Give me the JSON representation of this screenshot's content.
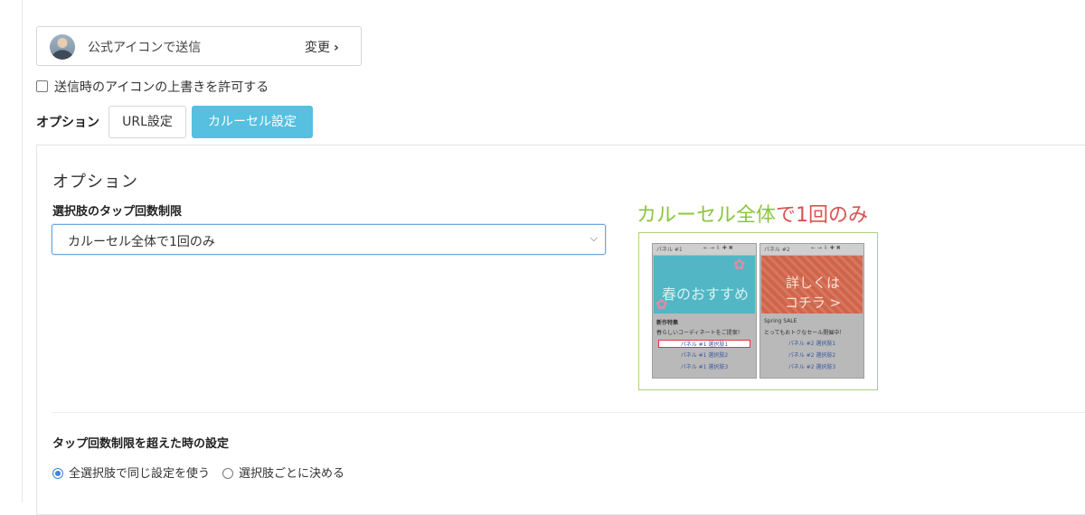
{
  "sender": {
    "label": "公式アイコンで送信",
    "change_label": "変更",
    "change_icon": "chevron-right-icon"
  },
  "override_checkbox": {
    "label": "送信時のアイコンの上書きを許可する",
    "checked": false
  },
  "options_tabs": {
    "label": "オプション",
    "tabs": [
      {
        "label": "URL設定",
        "active": false
      },
      {
        "label": "カルーセル設定",
        "active": true
      }
    ],
    "active_color": "#57bfe0"
  },
  "panel": {
    "title": "オプション",
    "tap_limit": {
      "label": "選択肢のタップ回数制限",
      "selected": "カルーセル全体で1回のみ"
    },
    "preview": {
      "caption_part1": "カルーセル全体",
      "caption_part2": "で1回のみ",
      "colors": {
        "green": "#8cc640",
        "red": "#d9534f"
      },
      "cards": [
        {
          "image_text": "春のおすすめ",
          "heading": "新作特集",
          "desc": "春らしいコーディネートをご提案！",
          "choices": [
            "パネル #1 選択肢1",
            "パネル #1 選択肢2",
            "パネル #1 選択肢3"
          ],
          "highlighted_choice": 0
        },
        {
          "image_text": "詳しくは\nコチラ >",
          "heading": "Spring SALE",
          "desc": "とってもおトクなセール開催中！",
          "choices": [
            "パネル #2 選択肢1",
            "パネル #2 選択肢2",
            "パネル #2 選択肢3"
          ],
          "highlighted_choice": -1
        }
      ]
    },
    "over_limit": {
      "title": "タップ回数制限を超えた時の設定",
      "options": [
        {
          "label": "全選択肢で同じ設定を使う",
          "selected": true
        },
        {
          "label": "選択肢ごとに決める",
          "selected": false
        }
      ]
    }
  }
}
